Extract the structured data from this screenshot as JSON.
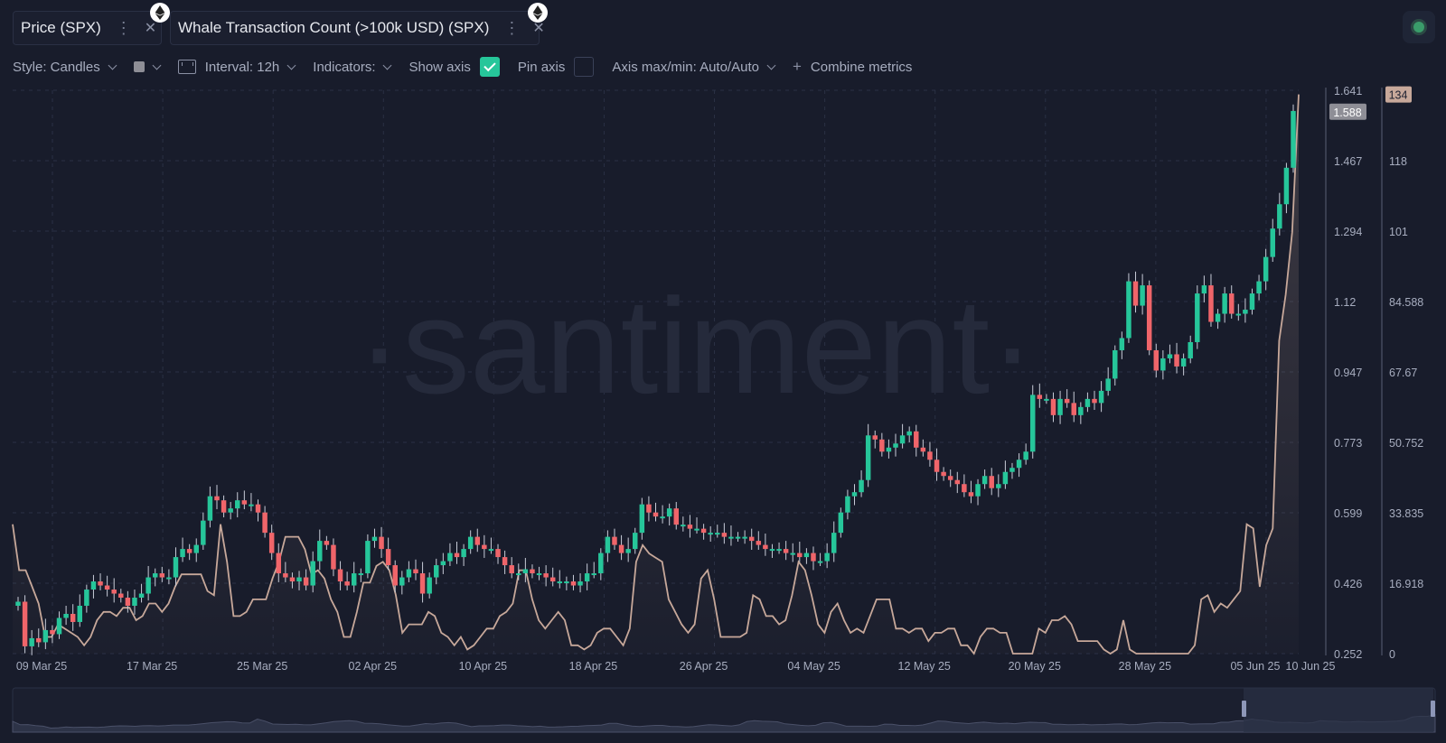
{
  "tabs": [
    {
      "label": "Price (SPX)",
      "accent": "#c7a89a"
    },
    {
      "label": "Whale Transaction Count (>100k USD) (SPX)",
      "accent": "#c7a89a"
    }
  ],
  "toolbar": {
    "style": "Style: Candles",
    "interval": "Interval: 12h",
    "indicators": "Indicators:",
    "show_axis": "Show axis",
    "show_axis_checked": true,
    "pin_axis": "Pin axis",
    "pin_axis_checked": false,
    "axis_maxmin": "Axis max/min: Auto/Auto",
    "combine": "Combine metrics"
  },
  "watermark": "·santiment·",
  "colors": {
    "up": "#26c69a",
    "down": "#f0656a",
    "line": "#c7a89a",
    "grid": "#2a3044",
    "background": "#181c2b"
  },
  "chart_data": {
    "type": "candlestick+line",
    "x_ticks": [
      "09 Mar 25",
      "17 Mar 25",
      "25 Mar 25",
      "02 Apr 25",
      "10 Apr 25",
      "18 Apr 25",
      "26 Apr 25",
      "04 May 25",
      "12 May 25",
      "20 May 25",
      "28 May 25",
      "05 Jun 25",
      "10 Jun 25"
    ],
    "left_axis": {
      "ticks": [
        "1.641",
        "1.467",
        "1.294",
        "1.12",
        "0.947",
        "0.773",
        "0.599",
        "0.426",
        "0.252"
      ],
      "range": [
        0.252,
        1.641
      ],
      "last_value": "1.588"
    },
    "right_axis": {
      "ticks": [
        "135",
        "118",
        "101",
        "84.588",
        "67.67",
        "50.752",
        "33.835",
        "16.918",
        "0"
      ],
      "range": [
        0,
        135
      ],
      "last_value": "134"
    },
    "price_closes": [
      0.38,
      0.27,
      0.29,
      0.28,
      0.31,
      0.3,
      0.34,
      0.35,
      0.33,
      0.37,
      0.41,
      0.43,
      0.42,
      0.41,
      0.4,
      0.39,
      0.37,
      0.39,
      0.4,
      0.44,
      0.45,
      0.44,
      0.44,
      0.49,
      0.51,
      0.5,
      0.52,
      0.58,
      0.64,
      0.63,
      0.6,
      0.61,
      0.63,
      0.62,
      0.62,
      0.6,
      0.55,
      0.5,
      0.45,
      0.44,
      0.43,
      0.44,
      0.42,
      0.48,
      0.53,
      0.52,
      0.46,
      0.43,
      0.42,
      0.45,
      0.45,
      0.53,
      0.54,
      0.51,
      0.47,
      0.42,
      0.44,
      0.46,
      0.45,
      0.4,
      0.44,
      0.47,
      0.48,
      0.5,
      0.49,
      0.51,
      0.54,
      0.52,
      0.51,
      0.51,
      0.49,
      0.47,
      0.45,
      0.45,
      0.46,
      0.45,
      0.45,
      0.44,
      0.43,
      0.43,
      0.43,
      0.42,
      0.43,
      0.45,
      0.45,
      0.5,
      0.54,
      0.52,
      0.5,
      0.51,
      0.55,
      0.62,
      0.6,
      0.59,
      0.59,
      0.61,
      0.57,
      0.57,
      0.56,
      0.56,
      0.55,
      0.55,
      0.55,
      0.54,
      0.54,
      0.54,
      0.54,
      0.53,
      0.52,
      0.51,
      0.51,
      0.51,
      0.5,
      0.5,
      0.49,
      0.5,
      0.48,
      0.48,
      0.5,
      0.55,
      0.6,
      0.64,
      0.65,
      0.68,
      0.79,
      0.78,
      0.75,
      0.76,
      0.77,
      0.79,
      0.8,
      0.76,
      0.75,
      0.73,
      0.7,
      0.69,
      0.68,
      0.67,
      0.65,
      0.64,
      0.67,
      0.69,
      0.66,
      0.67,
      0.7,
      0.71,
      0.73,
      0.75,
      0.89,
      0.88,
      0.88,
      0.84,
      0.88,
      0.87,
      0.84,
      0.86,
      0.88,
      0.87,
      0.9,
      0.93,
      1.0,
      1.03,
      1.17,
      1.11,
      1.16,
      1.0,
      0.95,
      0.98,
      0.99,
      0.96,
      0.98,
      1.02,
      1.14,
      1.16,
      1.07,
      1.09,
      1.14,
      1.09,
      1.09,
      1.1,
      1.14,
      1.17,
      1.23,
      1.3,
      1.36,
      1.45,
      1.59
    ],
    "whale_counts": [
      31,
      20,
      20,
      16,
      12,
      4,
      4,
      7,
      6,
      5,
      4,
      2,
      4,
      8,
      10,
      10,
      9,
      11,
      11,
      8,
      9,
      12,
      12,
      10,
      12,
      16,
      19,
      19,
      19,
      19,
      15,
      14,
      31,
      22,
      9,
      9,
      10,
      13,
      13,
      13,
      18,
      22,
      28,
      28,
      28,
      25,
      19,
      20,
      18,
      13,
      10,
      4,
      4,
      10,
      17,
      17,
      21,
      22,
      20,
      14,
      5,
      7,
      7,
      7,
      10,
      9,
      5,
      4,
      2,
      4,
      1,
      2,
      4,
      6,
      6,
      9,
      10,
      12,
      20,
      20,
      13,
      8,
      6,
      8,
      10,
      8,
      2,
      2,
      1,
      2,
      5,
      6,
      6,
      4,
      2,
      6,
      22,
      26,
      24,
      23,
      22,
      13,
      10,
      7,
      5,
      7,
      18,
      20,
      13,
      4,
      4,
      4,
      4,
      5,
      14,
      13,
      9,
      9,
      7,
      8,
      14,
      22,
      20,
      14,
      7,
      5,
      10,
      12,
      8,
      5,
      6,
      5,
      9,
      13,
      13,
      13,
      6,
      6,
      5,
      6,
      6,
      3,
      5,
      5,
      6,
      6,
      2,
      2,
      0,
      4,
      6,
      6,
      5,
      5,
      0,
      0,
      0,
      0,
      6,
      5,
      8,
      8,
      9,
      7,
      3,
      3,
      3,
      3,
      1,
      0,
      1,
      8,
      1,
      0,
      0,
      0,
      0,
      0,
      0,
      0,
      0,
      0,
      2,
      13,
      14,
      10,
      12,
      11,
      13,
      15,
      31,
      30,
      16,
      26,
      30,
      75,
      86,
      101,
      134
    ]
  }
}
